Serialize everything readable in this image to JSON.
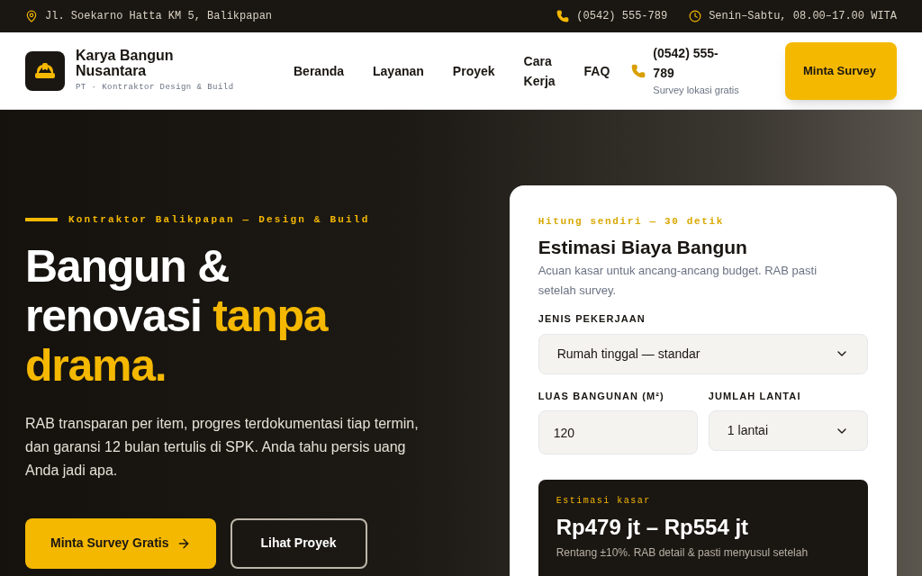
{
  "topbar": {
    "address": "Jl. Soekarno Hatta KM 5, Balikpapan",
    "phone": "(0542) 555-789",
    "hours": "Senin–Sabtu, 08.00–17.00 WITA"
  },
  "header": {
    "brand": "Karya Bangun Nusantara",
    "tagline": "PT · Kontraktor Design & Build",
    "nav": [
      {
        "label": "Beranda",
        "selected": false
      },
      {
        "label": "Layanan",
        "selected": false
      },
      {
        "label": "Proyek",
        "selected": false
      },
      {
        "label": "Cara Kerja",
        "selected": false
      },
      {
        "label": "FAQ",
        "selected": false
      }
    ],
    "phone": "(0542) 555-789",
    "phone_note": "Survey lokasi gratis",
    "cta": "Minta Survey"
  },
  "hero": {
    "eyebrow": "Kontraktor Balikpapan — Design & Build",
    "title_white": "Bangun & renovasi",
    "title_accent_inline": "tanpa",
    "title_accent": "drama.",
    "lead": "RAB transparan per item, progres terdokumentasi tiap termin, dan garansi 12 bulan tertulis di SPK. Anda tahu persis uang Anda jadi apa.",
    "buttons": [
      {
        "label": "Minta Survey Gratis",
        "kind": "primary"
      },
      {
        "label": "Lihat Proyek",
        "kind": "outline"
      }
    ]
  },
  "calculator": {
    "eyebrow": "Hitung sendiri — 30 detik",
    "title": "Estimasi Biaya Bangun",
    "description": "Acuan kasar untuk ancang-ancang budget. RAB pasti setelah survey.",
    "work_type": {
      "label": "JENIS PEKERJAAN",
      "value": "Rumah tinggal — standar"
    },
    "area": {
      "label": "LUAS BANGUNAN (M²)",
      "value": "120"
    },
    "floors": {
      "label": "JUMLAH LANTAI",
      "value": "1 lantai"
    },
    "result": {
      "label": "Estimasi kasar",
      "range": "Rp479 jt – Rp554 jt",
      "note": "Rentang ±10%. RAB detail & pasti menyusul setelah"
    }
  }
}
